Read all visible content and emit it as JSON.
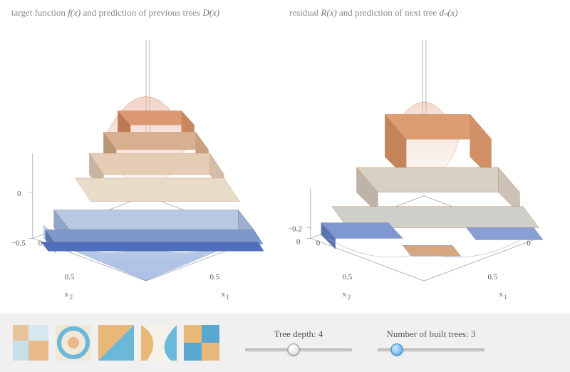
{
  "left_plot": {
    "title_prefix": "target function ",
    "title_fn1": "f(x)",
    "title_mid": " and prediction of previous trees ",
    "title_fn2": "D(x)",
    "z_ticks": [
      "0",
      "−0.5"
    ],
    "x1_tick": "0.5",
    "x2_tick": "0.5",
    "x1_zero": "0",
    "x2_zero": "0",
    "x1_label": "x",
    "x1_sub": "1",
    "x2_label": "x",
    "x2_sub": "2"
  },
  "right_plot": {
    "title_prefix": "residual ",
    "title_fn1": "R(x)",
    "title_mid": " and prediction of next tree ",
    "title_fn2": "dₙ(x)",
    "z_ticks": [
      "−0.2",
      "0"
    ],
    "x1_tick": "0.5",
    "x2_tick": "0.5",
    "x1_zero": "0",
    "x2_zero": "0",
    "x1_label": "x",
    "x1_sub": "1",
    "x2_label": "x",
    "x2_sub": "2"
  },
  "controls": {
    "tree_depth_label": "Tree depth: 4",
    "tree_depth_value": 4,
    "tree_depth_min": 1,
    "tree_depth_max": 8,
    "num_trees_label": "Number of built trees: 3",
    "num_trees_value": 3,
    "num_trees_min": 0,
    "num_trees_max": 50
  },
  "chart_data": [
    {
      "type": "surface",
      "title": "target function f(x) and prediction of previous trees D(x)",
      "xlabel": "x1",
      "ylabel": "x2",
      "zlabel": "",
      "x_range": [
        0,
        1
      ],
      "y_range": [
        0,
        1
      ],
      "z_range": [
        -0.5,
        0.8
      ],
      "tick_x": [
        0,
        0.5
      ],
      "tick_y": [
        0,
        0.5
      ],
      "tick_z": [
        -0.5,
        0
      ],
      "surfaces": [
        {
          "name": "f(x)",
          "style": "smooth-translucent",
          "peak": 0.8,
          "min": -0.5
        },
        {
          "name": "D(x)",
          "style": "stepped-opaque",
          "peak": 0.6,
          "min": -0.4
        }
      ],
      "colormap": "blue-orange-diverging"
    },
    {
      "type": "surface",
      "title": "residual R(x) and prediction of next tree d_n(x)",
      "xlabel": "x1",
      "ylabel": "x2",
      "zlabel": "",
      "x_range": [
        0,
        1
      ],
      "y_range": [
        0,
        1
      ],
      "z_range": [
        -0.2,
        0.3
      ],
      "tick_x": [
        0,
        0.5
      ],
      "tick_y": [
        0,
        0.5
      ],
      "tick_z": [
        -0.2,
        0
      ],
      "surfaces": [
        {
          "name": "R(x)",
          "style": "smooth-translucent",
          "peak": 0.3,
          "min": -0.2
        },
        {
          "name": "d_n(x)",
          "style": "stepped-opaque",
          "peak": 0.22,
          "min": -0.15
        }
      ],
      "colormap": "blue-orange-diverging"
    }
  ]
}
